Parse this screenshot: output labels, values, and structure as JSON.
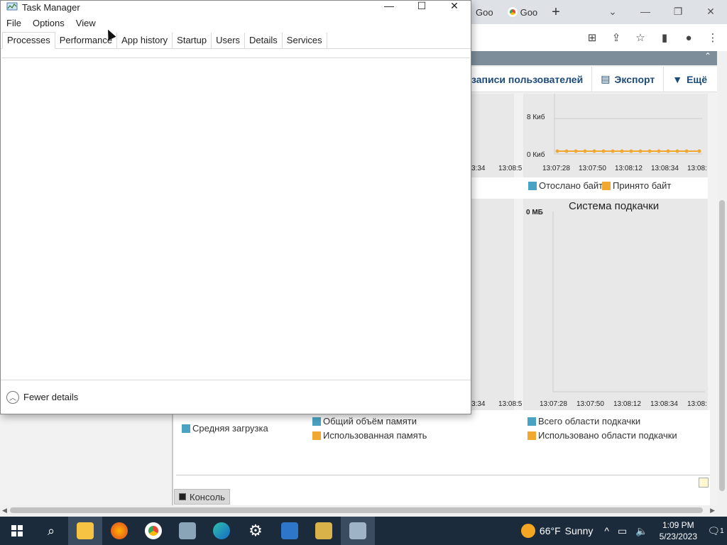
{
  "task_manager": {
    "title": "Task Manager",
    "window_controls": {
      "minimize": "—",
      "maximize": "☐",
      "close": "✕"
    },
    "menu": [
      "File",
      "Options",
      "View"
    ],
    "tabs": [
      "Processes",
      "Performance",
      "App history",
      "Startup",
      "Users",
      "Details",
      "Services"
    ],
    "active_tab": "Processes",
    "footer": "Fewer details"
  },
  "browser": {
    "tabs": [
      "Goo",
      "Goo"
    ],
    "new_tab": "+",
    "controls": {
      "dropdown": "⌄",
      "minimize": "—",
      "restore": "❐",
      "close": "✕"
    },
    "toolbar_icons": [
      "translate-icon",
      "share-icon",
      "star-icon",
      "sidebar-icon",
      "profile-icon",
      "menu-icon"
    ]
  },
  "page": {
    "toolbar": {
      "user_records": "записи пользователей",
      "export": "Экспорт",
      "more": "Ещё"
    },
    "network_chart": {
      "y_ticks": [
        "8 Киб",
        "0 Киб"
      ],
      "x_ticks_left": [
        "3:34",
        "13:08:5"
      ],
      "x_ticks": [
        "13:07:28",
        "13:07:50",
        "13:08:12",
        "13:08:34",
        "13:08:"
      ],
      "legend": [
        "Отослано байт",
        "Принято байт"
      ]
    },
    "paging_chart": {
      "title": "Система подкачки",
      "y_ticks": [
        "0 МБ"
      ],
      "x_ticks_left": [
        "3:34",
        "13:08:5"
      ],
      "x_ticks": [
        "13:07:28",
        "13:07:50",
        "13:08:12",
        "13:08:34",
        "13:08:"
      ],
      "legend": [
        "Всего области подкачки",
        "Использовано области подкачки"
      ]
    },
    "load_legend": "Средняя загрузка",
    "memory_legend": [
      "Общий объём памяти",
      "Использованная память"
    ],
    "console_tab": "Консоль"
  },
  "taskbar": {
    "weather": {
      "temp": "66°F",
      "condition": "Sunny"
    },
    "clock": {
      "time": "1:09 PM",
      "date": "5/23/2023"
    },
    "notifications": "1"
  }
}
